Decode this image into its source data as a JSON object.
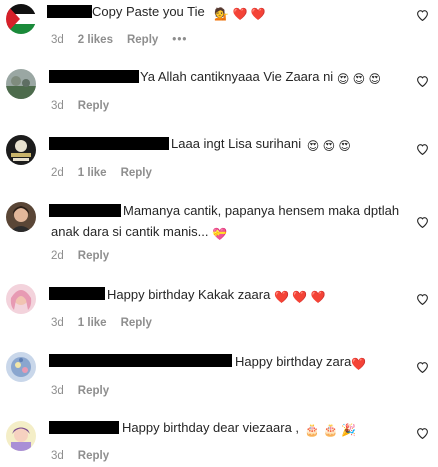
{
  "comments": [
    {
      "text": "Copy Paste you Tie",
      "emojis": "💁 ❤️ ❤️",
      "age": "3d",
      "likes": "2 likes",
      "reply": "Reply",
      "more": "•••"
    },
    {
      "text": "Ya Allah cantiknyaaa Vie Zaara ni",
      "emojis": "😍 😍 😍",
      "age": "3d",
      "reply": "Reply"
    },
    {
      "text": "Laaa ingt Lisa surihani",
      "emojis": "😍 😍 😍",
      "age": "2d",
      "likes": "1 like",
      "reply": "Reply"
    },
    {
      "text_line1": "Mamanya cantik, papanya hensem maka dptlah",
      "text_line2": "anak dara si cantik manis...",
      "emojis": "💝",
      "age": "2d",
      "reply": "Reply"
    },
    {
      "text": "Happy birthday Kakak zaara",
      "emojis": "❤️ ❤️ ❤️",
      "age": "3d",
      "likes": "1 like",
      "reply": "Reply"
    },
    {
      "text": "Happy birthday zara",
      "emojis": "❤️",
      "age": "3d",
      "reply": "Reply"
    },
    {
      "text": "Happy birthday dear viezaara ,",
      "emojis": "🎂 🎂 🎉",
      "age": "3d",
      "reply": "Reply"
    }
  ],
  "colors": {
    "text": "#262626",
    "meta": "#8e8e8e",
    "redaction": "#000000",
    "heart_outline": "#262626"
  },
  "icons": {
    "like": "heart-outline-icon"
  }
}
